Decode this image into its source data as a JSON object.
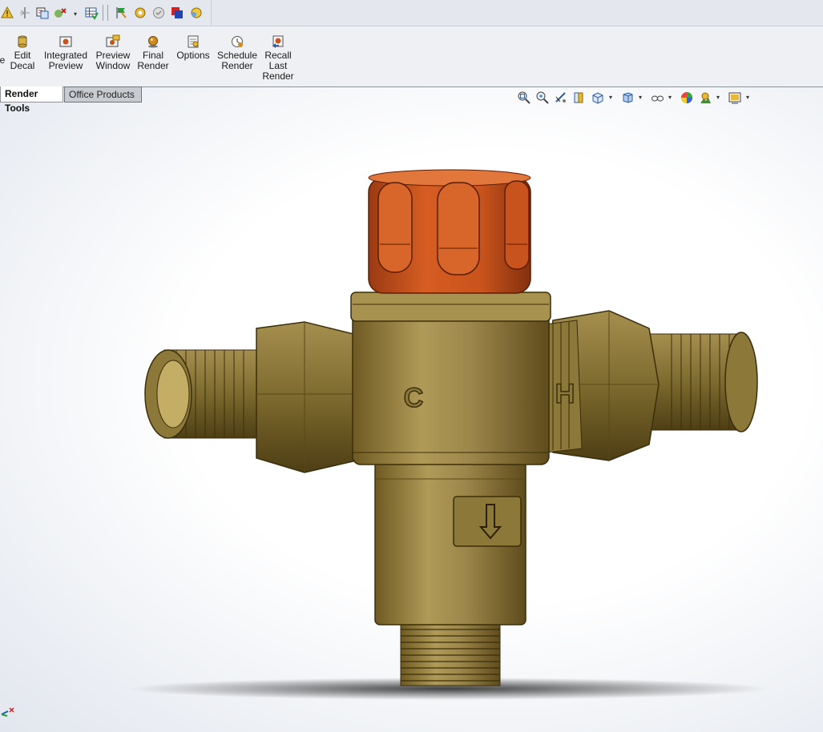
{
  "ribbon": {
    "commands": [
      {
        "label_line1": "Edit",
        "label_line2": "Decal",
        "label_line3": "",
        "icon": "decal-icon"
      },
      {
        "label_line1": "Integrated",
        "label_line2": "Preview",
        "label_line3": "",
        "icon": "integrated-preview-icon"
      },
      {
        "label_line1": "Preview",
        "label_line2": "Window",
        "label_line3": "",
        "icon": "preview-window-icon"
      },
      {
        "label_line1": "Final",
        "label_line2": "Render",
        "label_line3": "",
        "icon": "final-render-icon"
      },
      {
        "label_line1": "Options",
        "label_line2": "",
        "label_line3": "",
        "icon": "options-icon"
      },
      {
        "label_line1": "Schedule",
        "label_line2": "Render",
        "label_line3": "",
        "icon": "schedule-render-icon"
      },
      {
        "label_line1": "Recall",
        "label_line2": "Last",
        "label_line3": "Render",
        "icon": "recall-last-render-icon"
      }
    ],
    "cut_label": "e"
  },
  "tabs": [
    {
      "label": "Render Tools",
      "active": true
    },
    {
      "label": "Office Products",
      "active": false
    }
  ],
  "model": {
    "cold_letter": "C",
    "hot_letter": "H",
    "colors": {
      "brass": "#a08a4a",
      "brass_dark": "#6e5a22",
      "knob": "#c8531c",
      "knob_dark": "#8c3210"
    }
  },
  "colors": {
    "toolbar_bg": "#e4e7ed",
    "ribbon_bg": "#eef0f3",
    "active_tab": "#ffffff",
    "inactive_tab": "#c8cbd0"
  }
}
